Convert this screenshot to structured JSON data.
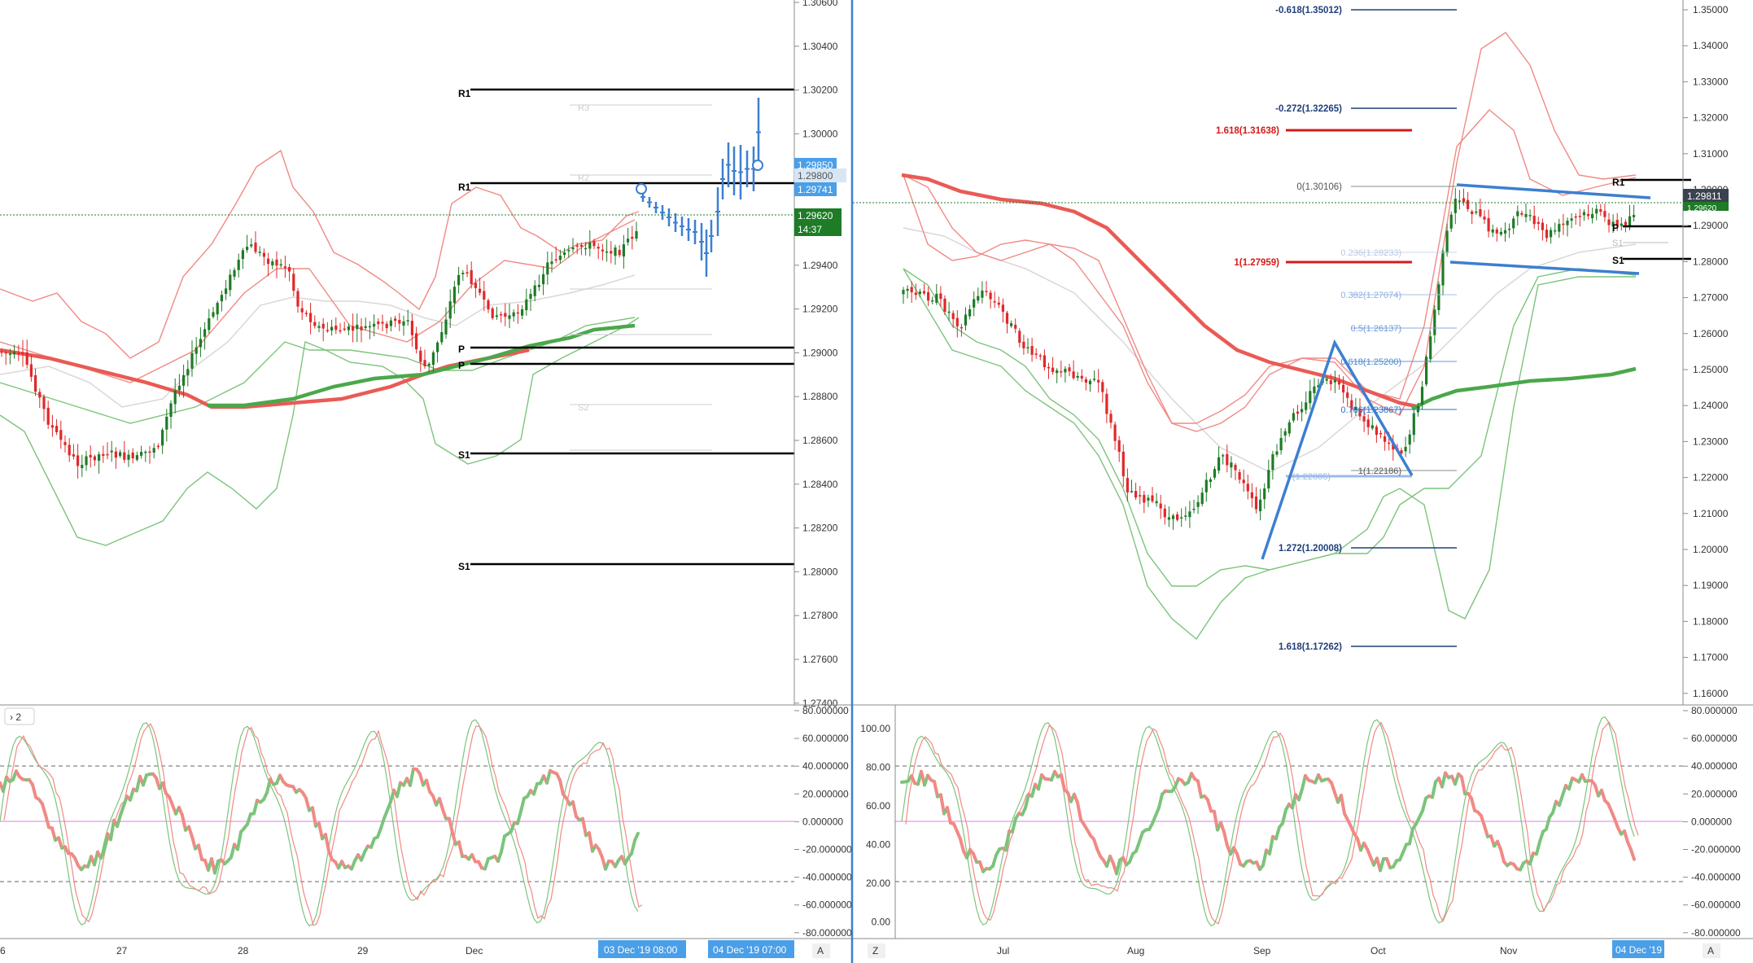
{
  "left_panel": {
    "price_axis": [
      "1.30600",
      "1.30400",
      "1.30200",
      "1.30000",
      "1.29800",
      "1.29600",
      "1.29400",
      "1.29200",
      "1.29000",
      "1.28800",
      "1.28600",
      "1.28400",
      "1.28200",
      "1.28000",
      "1.27800",
      "1.27600",
      "1.27400"
    ],
    "price_badges": [
      {
        "label": "1.29850",
        "color": "#4a9fe8"
      },
      {
        "label": "1.29800",
        "color": "#d7e6f5"
      },
      {
        "label": "1.29741",
        "color": "#4a9fe8"
      },
      {
        "label": "1.29620",
        "color": "#1e7b26"
      },
      {
        "label": "14:37",
        "color": "#1e7b26"
      }
    ],
    "pivot_labels": [
      "R1",
      "R1",
      "P",
      "P",
      "S1",
      "S1"
    ],
    "faint_labels": [
      "R3",
      "R2",
      "S2"
    ],
    "time_axis": [
      "6",
      "27",
      "28",
      "29",
      "Dec"
    ],
    "time_badges": [
      "03 Dec '19   08:00",
      "04 Dec '19   07:00"
    ],
    "corner_button": "A",
    "legend_button": "› 2",
    "osc_axis": [
      "80.000000",
      "60.000000",
      "40.000000",
      "20.000000",
      "0.000000",
      "-20.000000",
      "-40.000000",
      "-60.000000",
      "-80.000000"
    ]
  },
  "right_panel": {
    "price_axis": [
      "1.35000",
      "1.34000",
      "1.33000",
      "1.32000",
      "1.31000",
      "1.30000",
      "1.29000",
      "1.28000",
      "1.27000",
      "1.26000",
      "1.25000",
      "1.24000",
      "1.23000",
      "1.22000",
      "1.21000",
      "1.20000",
      "1.19000",
      "1.18000",
      "1.17000",
      "1.16000"
    ],
    "price_badges": [
      {
        "label": "1.29811",
        "color": "#3b4250"
      },
      {
        "label": "1.29620",
        "color": "#1e7b26"
      }
    ],
    "pivot_labels": [
      "R1",
      "P",
      "S1"
    ],
    "faint_labels": [
      "S1"
    ],
    "fib_big": [
      {
        "label": "-0.618(1.35012)",
        "color": "#1f3f7a"
      },
      {
        "label": "-0.272(1.32265)",
        "color": "#1f3f7a"
      },
      {
        "label": "0(1.30106)",
        "color": "#555555"
      },
      {
        "label": "1.272(1.20008)",
        "color": "#1f3f7a"
      },
      {
        "label": "1.618(1.17262)",
        "color": "#1f3f7a"
      }
    ],
    "fib_red": [
      {
        "label": "1.618(1.31638)",
        "color": "#d41a1a"
      },
      {
        "label": "1(1.27959)",
        "color": "#d41a1a"
      }
    ],
    "fib_light": [
      {
        "label": "0.236(1.28233)",
        "color": "#b9c9e6"
      },
      {
        "label": "0.382(1.27074)",
        "color": "#8fb0e0"
      },
      {
        "label": "0.5(1.26137)",
        "color": "#6f9ad8"
      },
      {
        "label": "0.618(1.25200)",
        "color": "#4e86d0"
      },
      {
        "label": "0.786(1.23867)",
        "color": "#2f6fc2"
      },
      {
        "label": "1(1.22186)",
        "color": "#555555"
      },
      {
        "label": "(1.22005)",
        "color": "#9bbbe8"
      }
    ],
    "time_axis": [
      "Jul",
      "Aug",
      "Sep",
      "Oct",
      "Nov"
    ],
    "time_badges": [
      "04 Dec '19"
    ],
    "corner_button": "A",
    "left_button": "Z",
    "osc_left_axis": [
      "100.00",
      "80.00",
      "60.00",
      "40.00",
      "20.00",
      "0.00"
    ],
    "osc_axis": [
      "80.000000",
      "60.000000",
      "40.000000",
      "20.000000",
      "0.000000",
      "-20.000000",
      "-40.000000",
      "-60.000000",
      "-80.000000"
    ]
  },
  "colors": {
    "up": "#1e7b26",
    "down": "#e0282a",
    "pivot": "#000000",
    "bb_red": "#f08a85",
    "bb_green": "#7cc47c",
    "ma_red": "#ea5a55",
    "ma_green": "#4aa84a",
    "blue": "#3d7fd0",
    "grid": "#e8e8e8"
  }
}
